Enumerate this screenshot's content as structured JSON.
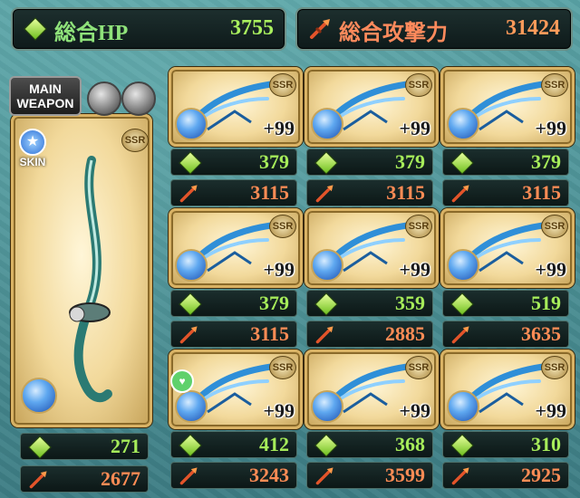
{
  "summary": {
    "hp_label": "総合HP",
    "hp_value": "3755",
    "atk_label": "総合攻撃力",
    "atk_value": "31424"
  },
  "main_weapon": {
    "badge_line1": "MAIN",
    "badge_line2": "WEAPON",
    "skin_label": "SKIN",
    "hp": "271",
    "atk": "2677"
  },
  "grid": [
    {
      "plus": "+99",
      "rarity": "SSR",
      "hp": "379",
      "atk": "3115"
    },
    {
      "plus": "+99",
      "rarity": "SSR",
      "hp": "379",
      "atk": "3115"
    },
    {
      "plus": "+99",
      "rarity": "SSR",
      "hp": "379",
      "atk": "3115"
    },
    {
      "plus": "+99",
      "rarity": "SSR",
      "hp": "379",
      "atk": "3115"
    },
    {
      "plus": "+99",
      "rarity": "SSR",
      "hp": "359",
      "atk": "2885"
    },
    {
      "plus": "+99",
      "rarity": "SSR",
      "hp": "519",
      "atk": "3635"
    },
    {
      "plus": "+99",
      "rarity": "SSR",
      "hp": "412",
      "atk": "3243"
    },
    {
      "plus": "+99",
      "rarity": "SSR",
      "hp": "368",
      "atk": "3599"
    },
    {
      "plus": "+99",
      "rarity": "SSR",
      "hp": "310",
      "atk": "2925"
    }
  ],
  "colors": {
    "hp": "#a6ec5a",
    "atk": "#ff8c55",
    "frame_gold": "#d9b264",
    "background": "#4a8f95"
  },
  "icons": {
    "hp": "green-gem-icon",
    "atk": "sword-icon",
    "skill": "blue-skill-orb-icon",
    "locked": "gray-orb-icon",
    "favorite": "heart-icon"
  }
}
